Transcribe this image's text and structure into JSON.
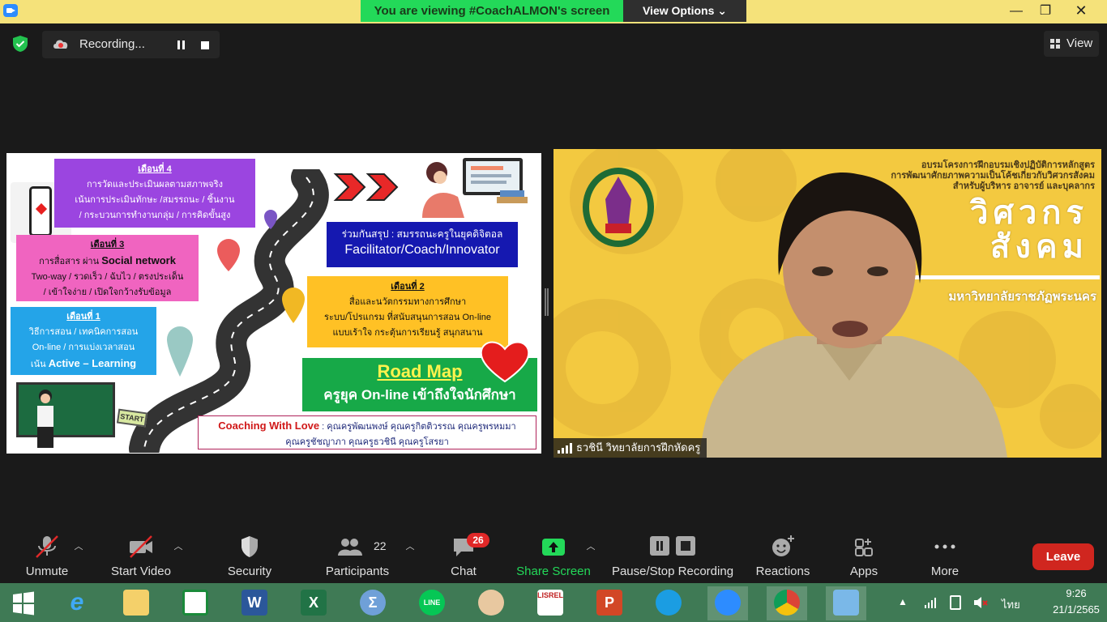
{
  "titlebar": {
    "viewing": "You are viewing #CoachALMON's screen",
    "view_options": "View Options ⌄",
    "minimize": "—",
    "maximize": "❐",
    "close": "✕"
  },
  "recording": {
    "label": "Recording..."
  },
  "view_button": "View",
  "slide": {
    "month4": {
      "heading": "เดือนที่ 4",
      "line1": "การวัดและประเมินผลตามสภาพจริง",
      "line2": "เน้นการประเมินทักษะ /สมรรถนะ / ชิ้นงาน",
      "line3": "/ กระบวนการทำงานกลุ่ม / การคิดขั้นสูง"
    },
    "month3": {
      "heading": "เดือนที่ 3",
      "line1_prefix": "การสื่อสาร ผ่าน ",
      "line1_big": "Social network",
      "line2": "Two-way / รวดเร็ว / ฉับไว / ตรงประเด็น",
      "line3": "/ เข้าใจง่าย / เปิดใจกว้างรับข้อมูล"
    },
    "month1": {
      "heading": "เดือนที่ 1",
      "line1": "วิธีการสอน / เทคนิคการสอน",
      "line2": "On-line / การแบ่งเวลาสอน",
      "line3_prefix": "เน้น ",
      "line3_big": "Active – Learning"
    },
    "month2": {
      "heading": "เดือนที่ 2",
      "line1": "สื่อและนวัตกรรมทางการศึกษา",
      "line2": "ระบบ/โปรแกรม ที่สนับสนุนการสอน On-line",
      "line3": "แบบเร้าใจ กระตุ้นการเรียนรู้ สนุกสนาน"
    },
    "summary": {
      "line1": "ร่วมกันสรุป : สมรรถนะครูในยุคดิจิตอล",
      "line2": "Facilitator/Coach/Innovator"
    },
    "roadmap": {
      "title": "Road  Map",
      "subtitle": "ครูยุค On-line  เข้าถึงใจนักศึกษา"
    },
    "coaching": {
      "title": "Coaching With Love",
      "line1": " : คุณครูพัฒนพงษ์ คุณครูกิตติวรรณ คุณครูพรหมมา",
      "line2": "คุณครูชัชญาภา คุณครูธวชินี คุณครูโสรยา"
    },
    "start_sign": "START"
  },
  "video": {
    "header_line1": "อบรมโครงการฝึกอบรมเชิงปฏิบัติการหลักสูตร",
    "header_line2": "การพัฒนาศักยภาพความเป็นโค้ชเกี่ยวกับวิศวกรสังคม",
    "header_line3": "สำหรับผู้บริหาร อาจารย์ และบุคลากร",
    "big_line1": "วิศวกร",
    "big_line2": "สังคม",
    "university": "มหาวิทยาลัยราชภัฏพระนคร",
    "name_tag": "ธวชินี  วิทยาลัยการฝึกหัดครู"
  },
  "toolbar": {
    "unmute": "Unmute",
    "start_video": "Start Video",
    "security": "Security",
    "participants": "Participants",
    "participants_count": "22",
    "chat": "Chat",
    "chat_badge": "26",
    "share_screen": "Share Screen",
    "pause_stop": "Pause/Stop Recording",
    "reactions": "Reactions",
    "apps": "Apps",
    "more": "More",
    "leave": "Leave"
  },
  "taskbar": {
    "tray_language": "ไทย",
    "time": "9:26",
    "date": "21/1/2565",
    "word_letter": "W",
    "excel_letter": "X",
    "ppt_letter": "P",
    "lisrel_label": "LISREL"
  },
  "colors": {
    "accent_green": "#23d959",
    "leave_red": "#d0261f",
    "taskbar": "#3f7a55"
  }
}
